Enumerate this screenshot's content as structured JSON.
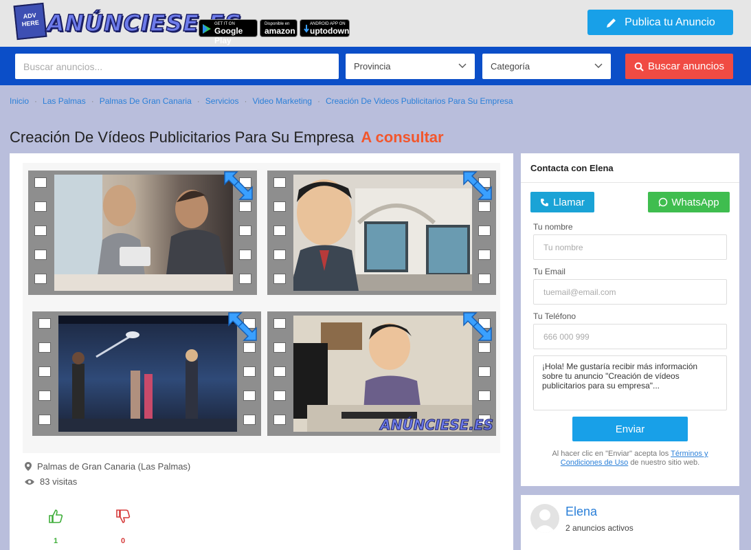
{
  "header": {
    "logo_badge": "ADV HERE",
    "logo_text": "ANÚNCIESE.ES",
    "stores": [
      {
        "small": "GET IT ON",
        "large": "Google Play"
      },
      {
        "small": "Disponible en",
        "large": "amazon"
      },
      {
        "small": "ANDROID APP ON",
        "large": "uptodown"
      }
    ],
    "publish_label": "Publica tu Anuncio"
  },
  "search": {
    "placeholder": "Buscar anuncios...",
    "province": "Provincia",
    "category": "Categoría",
    "button_label": "Buscar anuncios"
  },
  "breadcrumb": [
    "Inicio",
    "Las Palmas",
    "Palmas De Gran Canaria",
    "Servicios",
    "Video Marketing",
    "Creación De Videos Publicitarios Para Su Empresa"
  ],
  "listing": {
    "title": "Creación De Vídeos Publicitarios Para Su Empresa",
    "price": "A consultar",
    "watermark": "ANÚNCIESE.ES",
    "location": "Palmas de Gran Canaria (Las Palmas)",
    "visits": "83 visitas",
    "likes": "1",
    "dislikes": "0"
  },
  "contact": {
    "title": "Contacta con Elena",
    "call_label": "Llamar",
    "whatsapp_label": "WhatsApp",
    "name_label": "Tu nombre",
    "name_placeholder": "Tu nombre",
    "email_label": "Tu Email",
    "email_placeholder": "tuemail@email.com",
    "phone_label": "Tu Teléfono",
    "phone_placeholder": "666 000 999",
    "message": "¡Hola! Me gustaría recibir más información sobre tu anuncio \"Creación de vídeos publicitarios para su empresa\"...",
    "send_label": "Enviar",
    "terms_prefix": "Al hacer clic en \"Enviar\" acepta los",
    "terms_link": "Términos y Condiciones de Uso",
    "terms_suffix": "de nuestro sitio web."
  },
  "seller": {
    "name": "Elena",
    "ads": "2 anuncios activos"
  },
  "colors": {
    "primary": "#18a0e8",
    "nav": "#0b4ec8",
    "price": "#f2562c",
    "search": "#f04b43",
    "whatsapp": "#3fbd4f",
    "like": "#3fae3a",
    "dislike": "#d63a3a"
  }
}
